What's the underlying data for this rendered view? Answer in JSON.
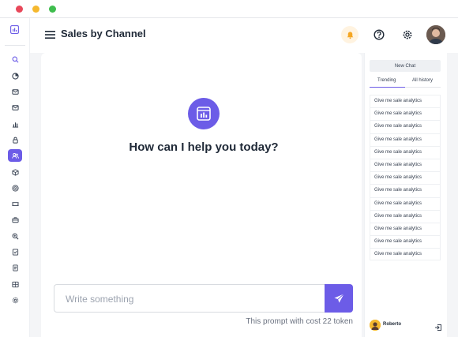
{
  "app": {
    "title": "Sales by Channel"
  },
  "colors": {
    "accent": "#6c5ce7",
    "bell_bg": "#fff3e0",
    "bell_icon": "#f5a623"
  },
  "sidebar": {
    "logo_icon": "chart-window-icon",
    "items": [
      {
        "icon": "search-icon",
        "active": false
      },
      {
        "icon": "pie-chart-icon",
        "active": false
      },
      {
        "icon": "mail-icon",
        "active": false
      },
      {
        "icon": "mail-check-icon",
        "active": false
      },
      {
        "icon": "bar-chart-icon",
        "active": false
      },
      {
        "icon": "lock-icon",
        "active": false
      },
      {
        "icon": "users-icon",
        "active": true
      },
      {
        "icon": "box-icon",
        "active": false
      },
      {
        "icon": "target-icon",
        "active": false
      },
      {
        "icon": "ticket-icon",
        "active": false
      },
      {
        "icon": "briefcase-icon",
        "active": false
      },
      {
        "icon": "zoom-icon",
        "active": false
      },
      {
        "icon": "checklist-icon",
        "active": false
      },
      {
        "icon": "document-icon",
        "active": false
      },
      {
        "icon": "grid-icon",
        "active": false
      },
      {
        "icon": "settings-icon",
        "active": false
      }
    ]
  },
  "header": {
    "icons": [
      "menu-icon",
      "bell-icon",
      "help-icon",
      "gear-icon",
      "avatar"
    ]
  },
  "main": {
    "greeting": "How can I help you today?",
    "prompt": {
      "placeholder": "Write something",
      "cost_note": "This prompt with cost 22 token"
    }
  },
  "panel": {
    "new_chat_label": "New Chat",
    "tabs": [
      {
        "label": "Trending",
        "active": true
      },
      {
        "label": "All history",
        "active": false
      }
    ],
    "history": [
      "Give me sale analytics",
      "Give me sale analytics",
      "Give me sale analytics",
      "Give me sale analytics",
      "Give me sale analytics",
      "Give me sale analytics",
      "Give me sale analytics",
      "Give me sale analytics",
      "Give me sale analytics",
      "Give me sale analytics",
      "Give me sale analytics",
      "Give me sale analytics",
      "Give me sale analytics"
    ],
    "user": {
      "name": "Roberto"
    }
  }
}
